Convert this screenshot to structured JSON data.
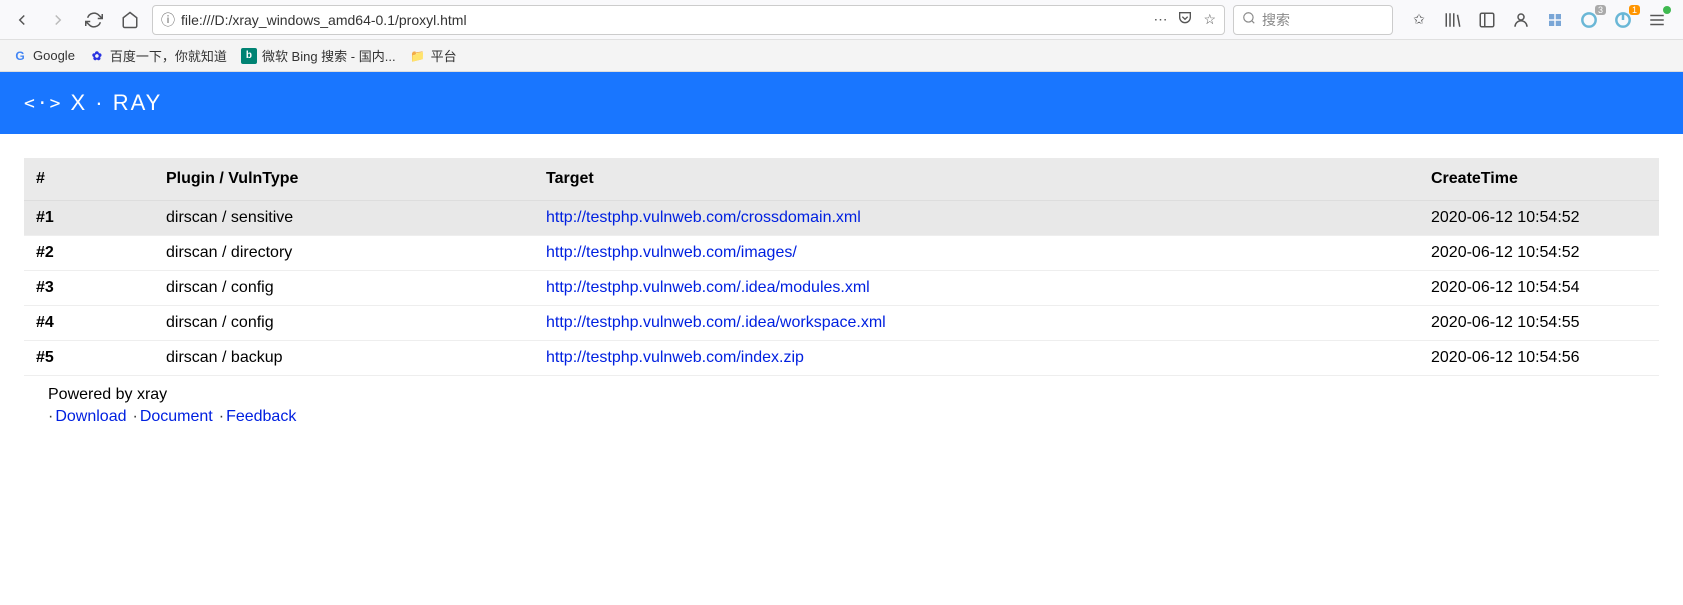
{
  "browser": {
    "url": "file:///D:/xray_windows_amd64-0.1/proxyl.html",
    "search_placeholder": "搜索",
    "bookmarks": [
      {
        "label": "Google",
        "iconClass": "bm-g",
        "iconText": "G"
      },
      {
        "label": "百度一下，你就知道",
        "iconClass": "bm-baidu",
        "iconText": "✿"
      },
      {
        "label": "微软 Bing 搜索 - 国内...",
        "iconClass": "bm-bing",
        "iconText": "b"
      },
      {
        "label": "平台",
        "iconClass": "bm-folder",
        "iconText": "📁"
      }
    ],
    "ext_badges": {
      "ext2": "3",
      "ext3": "1"
    }
  },
  "page": {
    "logo_text": "X · RAY",
    "table": {
      "headers": {
        "id": "#",
        "plugin": "Plugin / VulnType",
        "target": "Target",
        "time": "CreateTime"
      },
      "rows": [
        {
          "id": "#1",
          "plugin": "dirscan / sensitive",
          "target": "http://testphp.vulnweb.com/crossdomain.xml",
          "time": "2020-06-12 10:54:52",
          "highlight": true
        },
        {
          "id": "#2",
          "plugin": "dirscan / directory",
          "target": "http://testphp.vulnweb.com/images/",
          "time": "2020-06-12 10:54:52",
          "highlight": false
        },
        {
          "id": "#3",
          "plugin": "dirscan / config",
          "target": "http://testphp.vulnweb.com/.idea/modules.xml",
          "time": "2020-06-12 10:54:54",
          "highlight": false
        },
        {
          "id": "#4",
          "plugin": "dirscan / config",
          "target": "http://testphp.vulnweb.com/.idea/workspace.xml",
          "time": "2020-06-12 10:54:55",
          "highlight": false
        },
        {
          "id": "#5",
          "plugin": "dirscan / backup",
          "target": "http://testphp.vulnweb.com/index.zip",
          "time": "2020-06-12 10:54:56",
          "highlight": false
        }
      ]
    },
    "footer": {
      "powered": "Powered by xray",
      "links": [
        {
          "label": "Download"
        },
        {
          "label": "Document"
        },
        {
          "label": "Feedback"
        }
      ]
    }
  }
}
